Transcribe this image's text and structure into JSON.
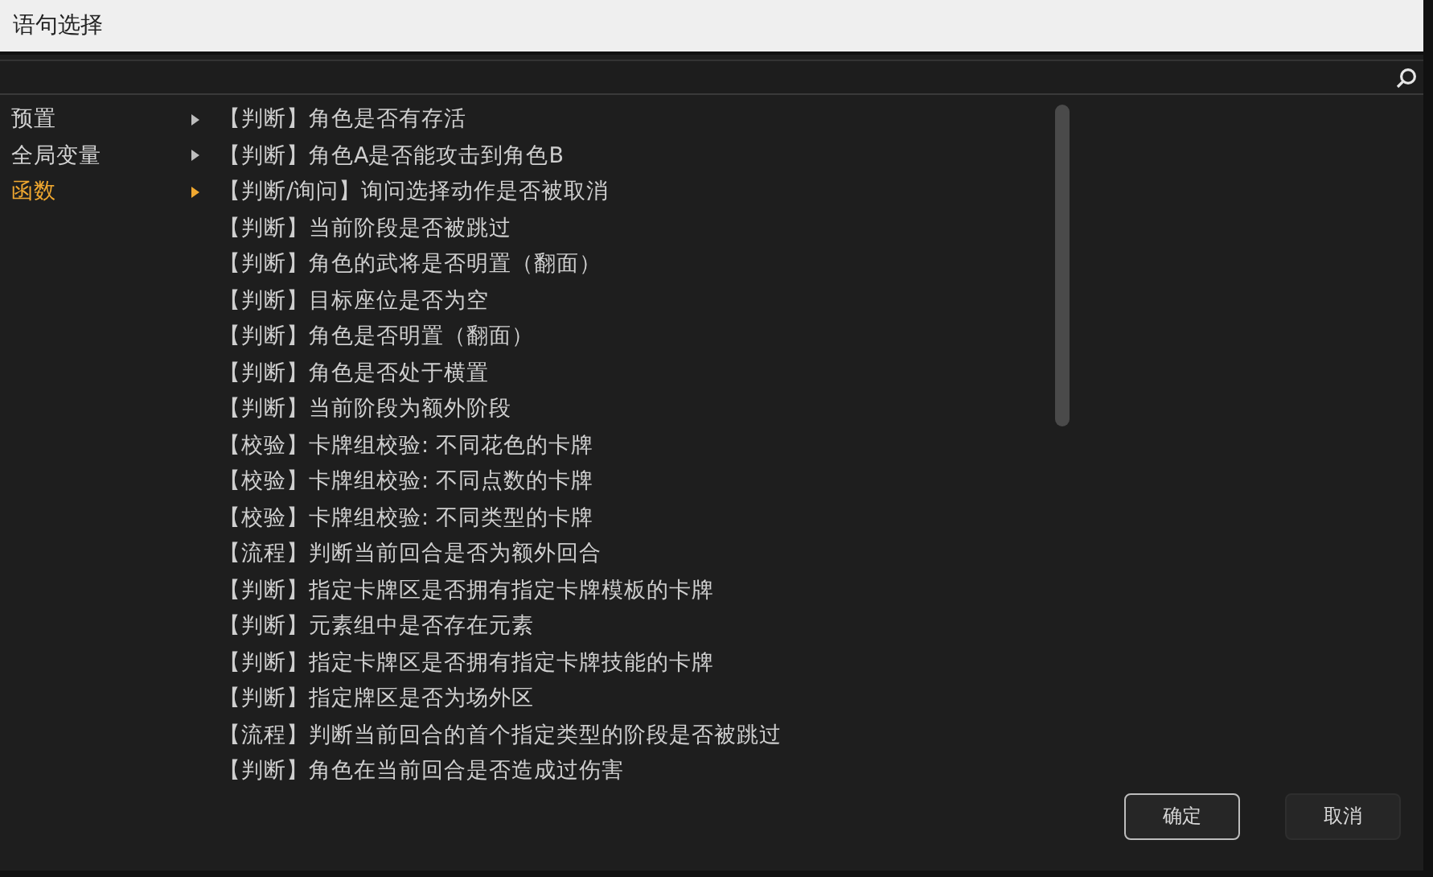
{
  "window": {
    "title": "语句选择"
  },
  "categories": [
    {
      "label": "预置",
      "selected": false
    },
    {
      "label": "全局变量",
      "selected": false
    },
    {
      "label": "函数",
      "selected": true
    }
  ],
  "statements": [
    "【判断】角色是否有存活",
    "【判断】角色A是否能攻击到角色B",
    "【判断/询问】询问选择动作是否被取消",
    "【判断】当前阶段是否被跳过",
    "【判断】角色的武将是否明置（翻面）",
    "【判断】目标座位是否为空",
    "【判断】角色是否明置（翻面）",
    "【判断】角色是否处于横置",
    "【判断】当前阶段为额外阶段",
    "【校验】卡牌组校验: 不同花色的卡牌",
    "【校验】卡牌组校验: 不同点数的卡牌",
    "【校验】卡牌组校验: 不同类型的卡牌",
    "【流程】判断当前回合是否为额外回合",
    "【判断】指定卡牌区是否拥有指定卡牌模板的卡牌",
    "【判断】元素组中是否存在元素",
    "【判断】指定卡牌区是否拥有指定卡牌技能的卡牌",
    "【判断】指定牌区是否为场外区",
    "【流程】判断当前回合的首个指定类型的阶段是否被跳过",
    "【判断】角色在当前回合是否造成过伤害"
  ],
  "buttons": [
    {
      "label": "确定",
      "kind": "primary"
    },
    {
      "label": "取消",
      "kind": "secondary"
    }
  ]
}
